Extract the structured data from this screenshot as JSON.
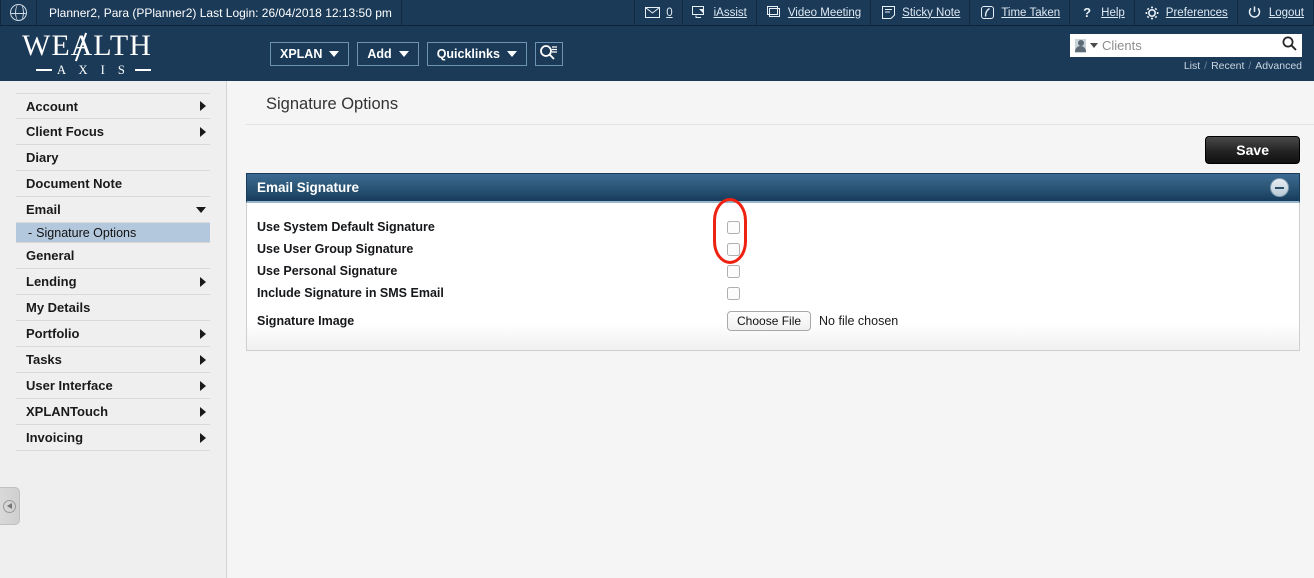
{
  "topbar": {
    "globe_icon": "globe-icon",
    "user_info": "Planner2, Para (PPlanner2) Last Login: 26/04/2018 12:13:50 pm",
    "mail_icon": "envelope-icon",
    "mail_count": "0",
    "items": [
      {
        "icon": "iassist-icon",
        "label": "iAssist"
      },
      {
        "icon": "video-meeting-icon",
        "label": "Video Meeting"
      },
      {
        "icon": "sticky-note-icon",
        "label": "Sticky Note"
      },
      {
        "icon": "time-taken-icon",
        "label": "Time Taken"
      },
      {
        "icon": "question-mark-icon",
        "label": "Help"
      },
      {
        "icon": "gear-icon",
        "label": "Preferences"
      },
      {
        "icon": "power-icon",
        "label": "Logout"
      }
    ]
  },
  "brand": {
    "name_main": "WEALTH",
    "name_sub": "A X I S"
  },
  "nav": {
    "buttons": [
      {
        "label": "XPLAN",
        "has_caret": true
      },
      {
        "label": "Add",
        "has_caret": true
      },
      {
        "label": "Quicklinks",
        "has_caret": true
      }
    ],
    "search_button_icon": "search-list-icon"
  },
  "search": {
    "scope_icon": "person-icon",
    "placeholder": "Clients",
    "value": "",
    "submit_icon": "search-icon",
    "links": [
      "List",
      "Recent",
      "Advanced"
    ],
    "separator": "/"
  },
  "sidebar": {
    "items": [
      {
        "label": "Account",
        "expandable": true,
        "expanded": false
      },
      {
        "label": "Client Focus",
        "expandable": true,
        "expanded": false
      },
      {
        "label": "Diary",
        "expandable": false,
        "expanded": false
      },
      {
        "label": "Document Note",
        "expandable": false,
        "expanded": false
      },
      {
        "label": "Email",
        "expandable": true,
        "expanded": true
      },
      {
        "label": "General",
        "expandable": false,
        "expanded": false
      },
      {
        "label": "Lending",
        "expandable": true,
        "expanded": false
      },
      {
        "label": "My Details",
        "expandable": false,
        "expanded": false
      },
      {
        "label": "Portfolio",
        "expandable": true,
        "expanded": false
      },
      {
        "label": "Tasks",
        "expandable": true,
        "expanded": false
      },
      {
        "label": "User Interface",
        "expandable": true,
        "expanded": false
      },
      {
        "label": "XPLANTouch",
        "expandable": true,
        "expanded": false
      },
      {
        "label": "Invoicing",
        "expandable": true,
        "expanded": false
      }
    ],
    "sub_item": {
      "dash": "-",
      "label": "Signature Options",
      "selected": true
    },
    "collapse_tab_icon": "collapse-sidebar-icon"
  },
  "main": {
    "page_title": "Signature Options",
    "save_label": "Save",
    "panel": {
      "title": "Email Signature",
      "collapse_icon": "minus-circle-icon",
      "rows": [
        {
          "label": "Use System Default Signature",
          "type": "checkbox",
          "checked": false
        },
        {
          "label": "Use User Group Signature",
          "type": "checkbox",
          "checked": false
        },
        {
          "label": "Use Personal Signature",
          "type": "checkbox",
          "checked": false
        },
        {
          "label": "Include Signature in SMS Email",
          "type": "checkbox",
          "checked": false
        },
        {
          "label": "Signature Image",
          "type": "file",
          "button_label": "Choose File",
          "status": "No file chosen"
        }
      ]
    },
    "annotation": {
      "shape": "ellipse",
      "color": "#ee2211"
    }
  },
  "colors": {
    "brand_navy": "#1b3a57",
    "panel_header_blue": "#2d5878",
    "sidebar_bg": "#efefef",
    "selected_subitem": "#b4c8dd",
    "annotation_red": "#ee2211"
  }
}
